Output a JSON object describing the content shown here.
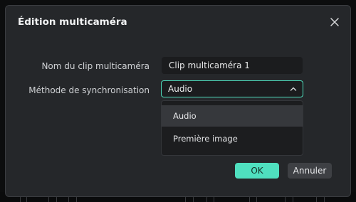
{
  "dialog": {
    "title": "Édition multicaméra",
    "close_icon": "close-icon"
  },
  "form": {
    "clip_name_label": "Nom du clip multicaméra",
    "clip_name_value": "Clip multicaméra 1",
    "sync_method_label": "Méthode de synchronisation",
    "sync_method_selected": "Audio",
    "sync_method_chevron_icon": "chevron-up-icon",
    "sync_method_options": [
      "Audio",
      "Première image"
    ]
  },
  "buttons": {
    "ok_label": "OK",
    "cancel_label": "Annuler"
  },
  "colors": {
    "accent": "#4fe0bf",
    "dialog_bg": "#25272a",
    "input_bg": "#1b1c1e",
    "highlight": "#36383c"
  }
}
